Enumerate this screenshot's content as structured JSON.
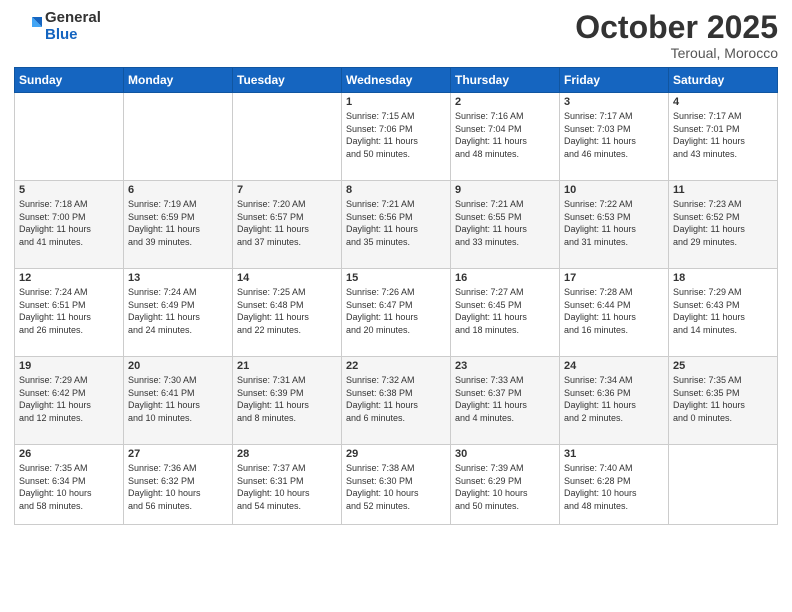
{
  "logo": {
    "general": "General",
    "blue": "Blue"
  },
  "title": "October 2025",
  "location": "Teroual, Morocco",
  "days_header": [
    "Sunday",
    "Monday",
    "Tuesday",
    "Wednesday",
    "Thursday",
    "Friday",
    "Saturday"
  ],
  "weeks": [
    [
      {
        "day": "",
        "info": ""
      },
      {
        "day": "",
        "info": ""
      },
      {
        "day": "",
        "info": ""
      },
      {
        "day": "1",
        "info": "Sunrise: 7:15 AM\nSunset: 7:06 PM\nDaylight: 11 hours\nand 50 minutes."
      },
      {
        "day": "2",
        "info": "Sunrise: 7:16 AM\nSunset: 7:04 PM\nDaylight: 11 hours\nand 48 minutes."
      },
      {
        "day": "3",
        "info": "Sunrise: 7:17 AM\nSunset: 7:03 PM\nDaylight: 11 hours\nand 46 minutes."
      },
      {
        "day": "4",
        "info": "Sunrise: 7:17 AM\nSunset: 7:01 PM\nDaylight: 11 hours\nand 43 minutes."
      }
    ],
    [
      {
        "day": "5",
        "info": "Sunrise: 7:18 AM\nSunset: 7:00 PM\nDaylight: 11 hours\nand 41 minutes."
      },
      {
        "day": "6",
        "info": "Sunrise: 7:19 AM\nSunset: 6:59 PM\nDaylight: 11 hours\nand 39 minutes."
      },
      {
        "day": "7",
        "info": "Sunrise: 7:20 AM\nSunset: 6:57 PM\nDaylight: 11 hours\nand 37 minutes."
      },
      {
        "day": "8",
        "info": "Sunrise: 7:21 AM\nSunset: 6:56 PM\nDaylight: 11 hours\nand 35 minutes."
      },
      {
        "day": "9",
        "info": "Sunrise: 7:21 AM\nSunset: 6:55 PM\nDaylight: 11 hours\nand 33 minutes."
      },
      {
        "day": "10",
        "info": "Sunrise: 7:22 AM\nSunset: 6:53 PM\nDaylight: 11 hours\nand 31 minutes."
      },
      {
        "day": "11",
        "info": "Sunrise: 7:23 AM\nSunset: 6:52 PM\nDaylight: 11 hours\nand 29 minutes."
      }
    ],
    [
      {
        "day": "12",
        "info": "Sunrise: 7:24 AM\nSunset: 6:51 PM\nDaylight: 11 hours\nand 26 minutes."
      },
      {
        "day": "13",
        "info": "Sunrise: 7:24 AM\nSunset: 6:49 PM\nDaylight: 11 hours\nand 24 minutes."
      },
      {
        "day": "14",
        "info": "Sunrise: 7:25 AM\nSunset: 6:48 PM\nDaylight: 11 hours\nand 22 minutes."
      },
      {
        "day": "15",
        "info": "Sunrise: 7:26 AM\nSunset: 6:47 PM\nDaylight: 11 hours\nand 20 minutes."
      },
      {
        "day": "16",
        "info": "Sunrise: 7:27 AM\nSunset: 6:45 PM\nDaylight: 11 hours\nand 18 minutes."
      },
      {
        "day": "17",
        "info": "Sunrise: 7:28 AM\nSunset: 6:44 PM\nDaylight: 11 hours\nand 16 minutes."
      },
      {
        "day": "18",
        "info": "Sunrise: 7:29 AM\nSunset: 6:43 PM\nDaylight: 11 hours\nand 14 minutes."
      }
    ],
    [
      {
        "day": "19",
        "info": "Sunrise: 7:29 AM\nSunset: 6:42 PM\nDaylight: 11 hours\nand 12 minutes."
      },
      {
        "day": "20",
        "info": "Sunrise: 7:30 AM\nSunset: 6:41 PM\nDaylight: 11 hours\nand 10 minutes."
      },
      {
        "day": "21",
        "info": "Sunrise: 7:31 AM\nSunset: 6:39 PM\nDaylight: 11 hours\nand 8 minutes."
      },
      {
        "day": "22",
        "info": "Sunrise: 7:32 AM\nSunset: 6:38 PM\nDaylight: 11 hours\nand 6 minutes."
      },
      {
        "day": "23",
        "info": "Sunrise: 7:33 AM\nSunset: 6:37 PM\nDaylight: 11 hours\nand 4 minutes."
      },
      {
        "day": "24",
        "info": "Sunrise: 7:34 AM\nSunset: 6:36 PM\nDaylight: 11 hours\nand 2 minutes."
      },
      {
        "day": "25",
        "info": "Sunrise: 7:35 AM\nSunset: 6:35 PM\nDaylight: 11 hours\nand 0 minutes."
      }
    ],
    [
      {
        "day": "26",
        "info": "Sunrise: 7:35 AM\nSunset: 6:34 PM\nDaylight: 10 hours\nand 58 minutes."
      },
      {
        "day": "27",
        "info": "Sunrise: 7:36 AM\nSunset: 6:32 PM\nDaylight: 10 hours\nand 56 minutes."
      },
      {
        "day": "28",
        "info": "Sunrise: 7:37 AM\nSunset: 6:31 PM\nDaylight: 10 hours\nand 54 minutes."
      },
      {
        "day": "29",
        "info": "Sunrise: 7:38 AM\nSunset: 6:30 PM\nDaylight: 10 hours\nand 52 minutes."
      },
      {
        "day": "30",
        "info": "Sunrise: 7:39 AM\nSunset: 6:29 PM\nDaylight: 10 hours\nand 50 minutes."
      },
      {
        "day": "31",
        "info": "Sunrise: 7:40 AM\nSunset: 6:28 PM\nDaylight: 10 hours\nand 48 minutes."
      },
      {
        "day": "",
        "info": ""
      }
    ]
  ]
}
